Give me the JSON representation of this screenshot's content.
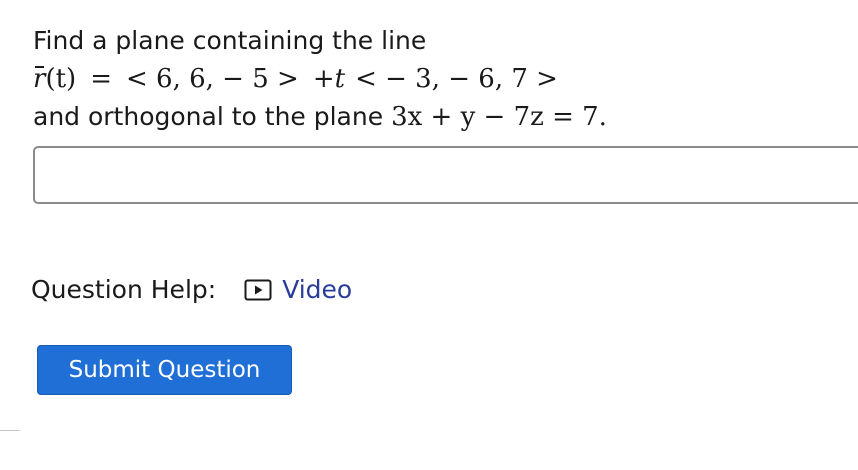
{
  "question": {
    "intro": "Find a plane containing the line",
    "line_eq": {
      "lhs_func": "r",
      "lhs_arg": "(t)",
      "equals": "=",
      "point": "< 6, 6,  − 5 >",
      "plus": "+",
      "param": "t",
      "direction": "<  − 3,  − 6, 7 >"
    },
    "condition_prefix": "and orthogonal to the plane",
    "plane_eq": "3x + y − 7z = 7."
  },
  "answer": {
    "value": "",
    "placeholder": ""
  },
  "help": {
    "label": "Question Help:",
    "video_label": "Video"
  },
  "submit": {
    "label": "Submit Question"
  },
  "colors": {
    "link": "#2a3c99",
    "button": "#1f6fd6"
  }
}
